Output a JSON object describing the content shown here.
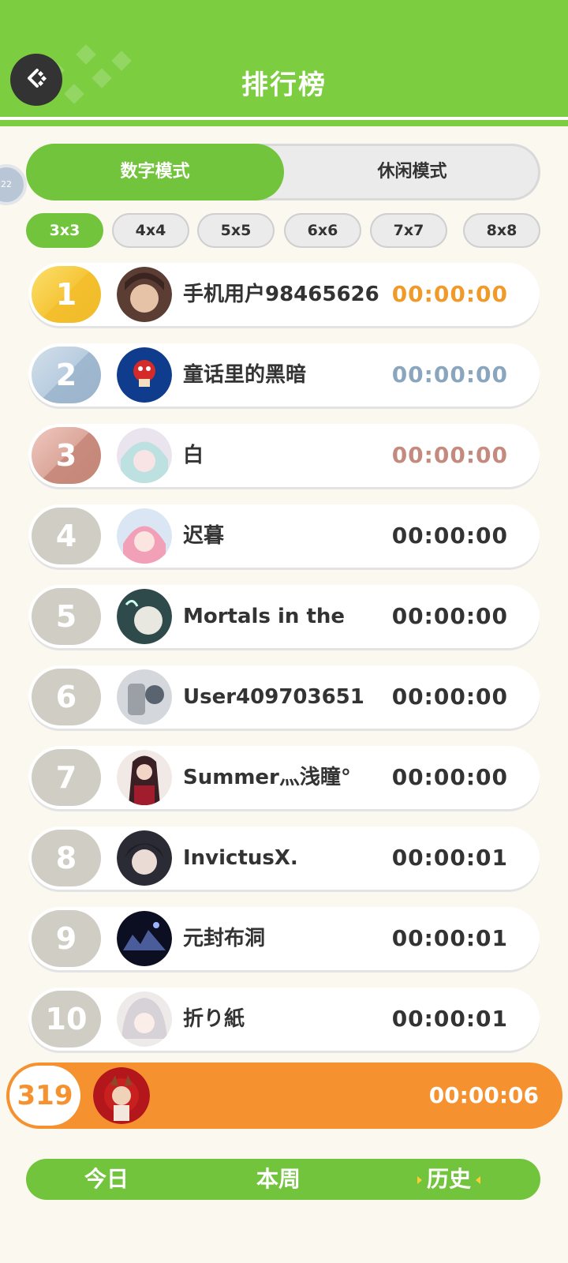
{
  "header": {
    "title": "排行榜"
  },
  "modes": [
    {
      "label": "数字模式",
      "active": true
    },
    {
      "label": "休闲模式",
      "active": false
    }
  ],
  "side_badge": "22",
  "sizes": [
    {
      "label": "3x3",
      "active": true
    },
    {
      "label": "4x4",
      "active": false
    },
    {
      "label": "5x5",
      "active": false
    },
    {
      "label": "6x6",
      "active": false
    },
    {
      "label": "7x7",
      "active": false
    },
    {
      "label": "8x8",
      "active": false
    }
  ],
  "leaderboard": [
    {
      "rank": "1",
      "name": "手机用户98465626",
      "time": "00:00:00",
      "medal": "gold"
    },
    {
      "rank": "2",
      "name": "童话里的黑暗",
      "time": "00:00:00",
      "medal": "silver"
    },
    {
      "rank": "3",
      "name": "白",
      "time": "00:00:00",
      "medal": "bronze"
    },
    {
      "rank": "4",
      "name": "迟暮",
      "time": "00:00:00",
      "medal": "none"
    },
    {
      "rank": "5",
      "name": "Mortals in the",
      "time": "00:00:00",
      "medal": "none"
    },
    {
      "rank": "6",
      "name": "User409703651",
      "time": "00:00:00",
      "medal": "none"
    },
    {
      "rank": "7",
      "name": "Summer灬浅瞳°",
      "time": "00:00:00",
      "medal": "none"
    },
    {
      "rank": "8",
      "name": "InvictusX.",
      "time": "00:00:01",
      "medal": "none"
    },
    {
      "rank": "9",
      "name": "元封布洞",
      "time": "00:00:01",
      "medal": "none"
    },
    {
      "rank": "10",
      "name": "折り紙",
      "time": "00:00:01",
      "medal": "none"
    }
  ],
  "my_entry": {
    "rank": "319",
    "time": "00:00:06"
  },
  "periods": [
    {
      "label": "今日",
      "active": false
    },
    {
      "label": "本周",
      "active": false
    },
    {
      "label": "历史",
      "active": true
    }
  ],
  "colors": {
    "brand_green": "#7dcd41",
    "gold": "#f09a2a",
    "silver": "#8aa6bf",
    "bronze": "#c48a7e",
    "my_row": "#f5922f"
  }
}
